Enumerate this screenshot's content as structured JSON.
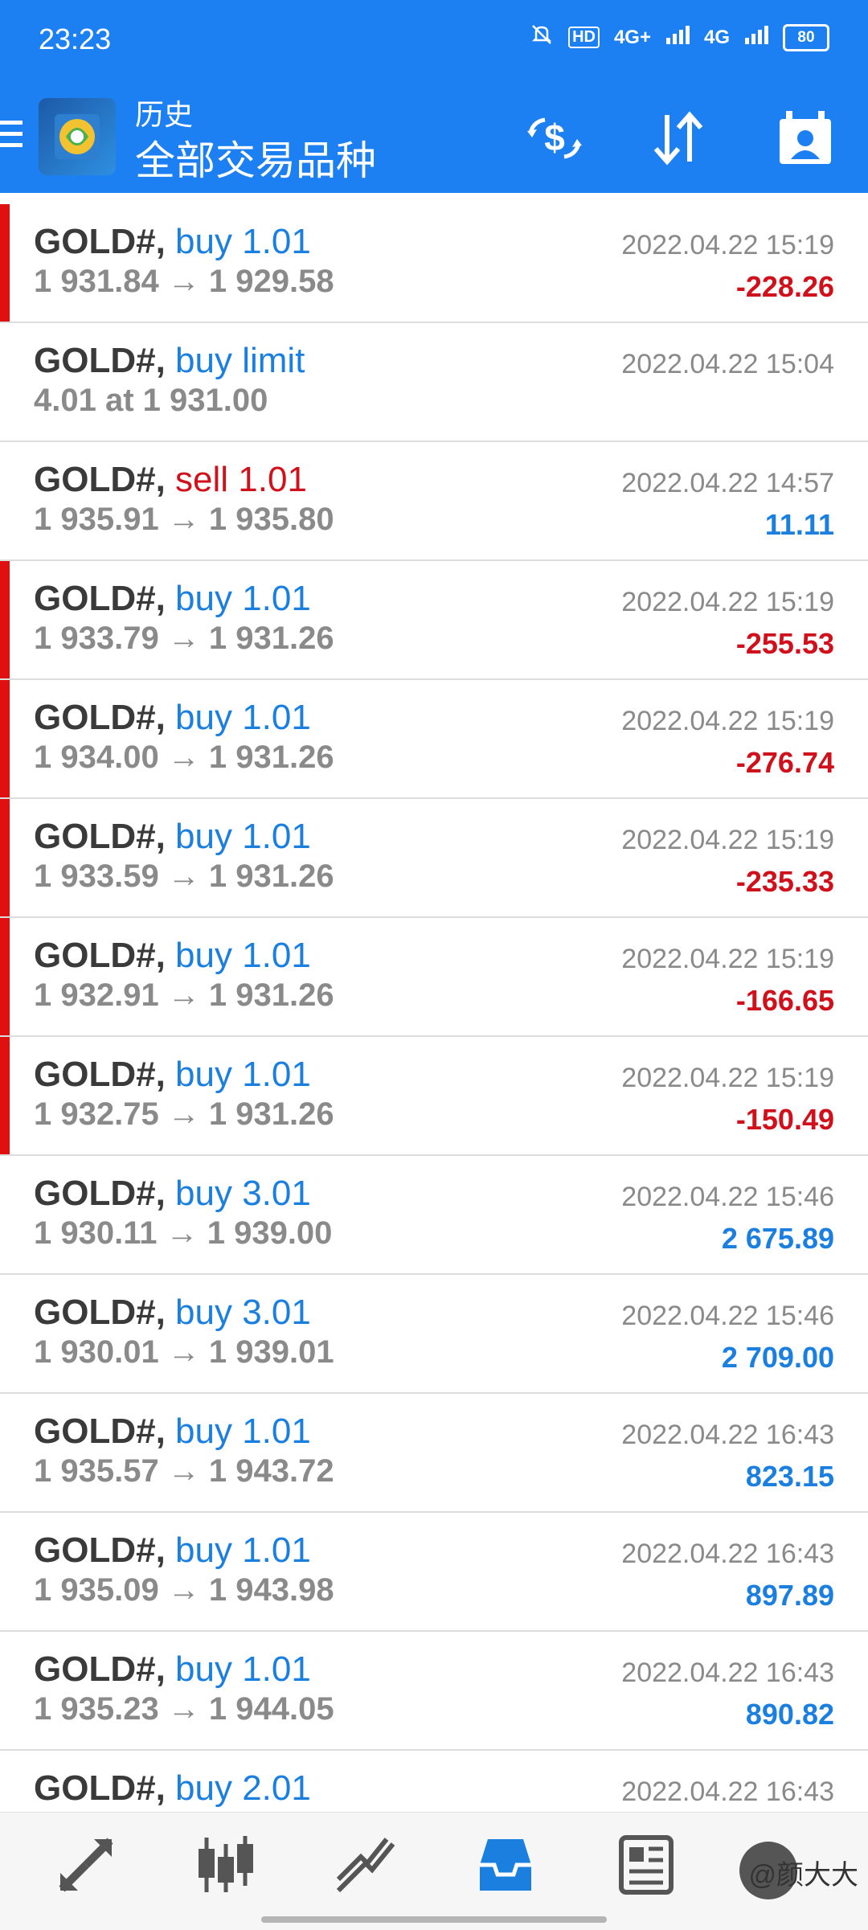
{
  "status_bar": {
    "time": "23:23",
    "network_1": "4G+",
    "network_2": "4G",
    "hd_label": "HD",
    "battery": "80"
  },
  "app_bar": {
    "title_small": "历史",
    "title_big": "全部交易品种",
    "icons": [
      "menu-icon",
      "metatrader-logo",
      "currency-exchange-icon",
      "sort-icon",
      "calendar-person-icon"
    ]
  },
  "trades": [
    {
      "symbol": "GOLD#,",
      "action": "buy 1.01",
      "side": "buy",
      "detail": "1 931.84 → 1 929.58",
      "time": "2022.04.22 15:19",
      "profit": "-228.26",
      "profit_sign": "neg",
      "flag": true
    },
    {
      "symbol": "GOLD#,",
      "action": "buy limit",
      "side": "buy",
      "detail": "4.01 at 1 931.00",
      "time": "2022.04.22 15:04",
      "profit": "",
      "profit_sign": "pos",
      "flag": false
    },
    {
      "symbol": "GOLD#,",
      "action": "sell 1.01",
      "side": "sell",
      "detail": "1 935.91 → 1 935.80",
      "time": "2022.04.22 14:57",
      "profit": "11.11",
      "profit_sign": "pos",
      "flag": false
    },
    {
      "symbol": "GOLD#,",
      "action": "buy 1.01",
      "side": "buy",
      "detail": "1 933.79 → 1 931.26",
      "time": "2022.04.22 15:19",
      "profit": "-255.53",
      "profit_sign": "neg",
      "flag": true
    },
    {
      "symbol": "GOLD#,",
      "action": "buy 1.01",
      "side": "buy",
      "detail": "1 934.00 → 1 931.26",
      "time": "2022.04.22 15:19",
      "profit": "-276.74",
      "profit_sign": "neg",
      "flag": true
    },
    {
      "symbol": "GOLD#,",
      "action": "buy 1.01",
      "side": "buy",
      "detail": "1 933.59 → 1 931.26",
      "time": "2022.04.22 15:19",
      "profit": "-235.33",
      "profit_sign": "neg",
      "flag": true
    },
    {
      "symbol": "GOLD#,",
      "action": "buy 1.01",
      "side": "buy",
      "detail": "1 932.91 → 1 931.26",
      "time": "2022.04.22 15:19",
      "profit": "-166.65",
      "profit_sign": "neg",
      "flag": true
    },
    {
      "symbol": "GOLD#,",
      "action": "buy 1.01",
      "side": "buy",
      "detail": "1 932.75 → 1 931.26",
      "time": "2022.04.22 15:19",
      "profit": "-150.49",
      "profit_sign": "neg",
      "flag": true
    },
    {
      "symbol": "GOLD#,",
      "action": "buy 3.01",
      "side": "buy",
      "detail": "1 930.11 → 1 939.00",
      "time": "2022.04.22 15:46",
      "profit": "2 675.89",
      "profit_sign": "pos",
      "flag": false
    },
    {
      "symbol": "GOLD#,",
      "action": "buy 3.01",
      "side": "buy",
      "detail": "1 930.01 → 1 939.01",
      "time": "2022.04.22 15:46",
      "profit": "2 709.00",
      "profit_sign": "pos",
      "flag": false
    },
    {
      "symbol": "GOLD#,",
      "action": "buy 1.01",
      "side": "buy",
      "detail": "1 935.57 → 1 943.72",
      "time": "2022.04.22 16:43",
      "profit": "823.15",
      "profit_sign": "pos",
      "flag": false
    },
    {
      "symbol": "GOLD#,",
      "action": "buy 1.01",
      "side": "buy",
      "detail": "1 935.09 → 1 943.98",
      "time": "2022.04.22 16:43",
      "profit": "897.89",
      "profit_sign": "pos",
      "flag": false
    },
    {
      "symbol": "GOLD#,",
      "action": "buy 1.01",
      "side": "buy",
      "detail": "1 935.23 → 1 944.05",
      "time": "2022.04.22 16:43",
      "profit": "890.82",
      "profit_sign": "pos",
      "flag": false
    },
    {
      "symbol": "GOLD#,",
      "action": "buy 2.01",
      "side": "buy",
      "detail": "",
      "time": "2022.04.22 16:43",
      "profit": "",
      "profit_sign": "pos",
      "flag": false
    }
  ],
  "bottom_nav": {
    "items": [
      "quotes-icon",
      "chart-icon",
      "trade-icon",
      "history-icon",
      "news-icon",
      "messages-icon"
    ],
    "watermark": "@颜大大"
  },
  "colors": {
    "header_blue": "#1d80f2",
    "buy_blue": "#1b7fe0",
    "sell_red": "#d0101a",
    "flag_red": "#e01010",
    "grey_text": "#8a8a8a"
  }
}
